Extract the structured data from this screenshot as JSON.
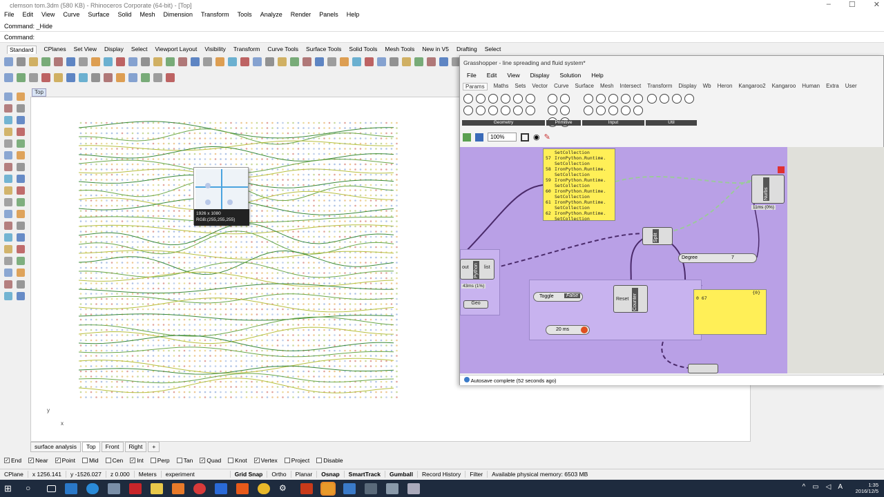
{
  "rhino": {
    "title": "clemson tom.3dm (580 KB) - Rhinoceros Corporate (64-bit) - [Top]",
    "menu": [
      "File",
      "Edit",
      "View",
      "Curve",
      "Surface",
      "Solid",
      "Mesh",
      "Dimension",
      "Transform",
      "Tools",
      "Analyze",
      "Render",
      "Panels",
      "Help"
    ],
    "command_history": "Command: _Hide",
    "command_prompt": "Command:",
    "toolbar_tabs": [
      "Standard",
      "CPlanes",
      "Set View",
      "Display",
      "Select",
      "Viewport Layout",
      "Visibility",
      "Transform",
      "Curve Tools",
      "Surface Tools",
      "Solid Tools",
      "Mesh Tools",
      "New in V5",
      "Drafting",
      "Select"
    ],
    "active_toolbar_tab": "Standard",
    "viewport_name": "Top",
    "axis_y": "y",
    "axis_x": "x",
    "tooltip": {
      "size": "1926 x 1080",
      "rgb": "RGB:(255,255,255)"
    },
    "view_tabs": [
      "surface analysis",
      "Top",
      "Front",
      "Right",
      "+"
    ],
    "active_view_tab": "Top",
    "osnaps": [
      {
        "label": "End",
        "checked": true
      },
      {
        "label": "Near",
        "checked": true
      },
      {
        "label": "Point",
        "checked": true
      },
      {
        "label": "Mid",
        "checked": false
      },
      {
        "label": "Cen",
        "checked": false
      },
      {
        "label": "Int",
        "checked": true
      },
      {
        "label": "Perp",
        "checked": false
      },
      {
        "label": "Tan",
        "checked": false
      },
      {
        "label": "Quad",
        "checked": true
      },
      {
        "label": "Knot",
        "checked": false
      },
      {
        "label": "Vertex",
        "checked": true
      },
      {
        "label": "Project",
        "checked": false
      },
      {
        "label": "Disable",
        "checked": false
      }
    ],
    "status": {
      "cplane": "CPlane",
      "x": "x 1256.141",
      "y": "y -1526.027",
      "z": "z 0.000",
      "units": "Meters",
      "layer": "experiment",
      "grid_snap": "Grid Snap",
      "ortho": "Ortho",
      "planar": "Planar",
      "osnap": "Osnap",
      "smarttrack": "SmartTrack",
      "gumball": "Gumball",
      "record_history": "Record History",
      "filter": "Filter",
      "memory": "Available physical memory: 6503 MB"
    }
  },
  "grasshopper": {
    "title": "Grasshopper - line spreading and fluid system*",
    "menu": [
      "File",
      "Edit",
      "View",
      "Display",
      "Solution",
      "Help"
    ],
    "tabs": [
      "Params",
      "Maths",
      "Sets",
      "Vector",
      "Curve",
      "Surface",
      "Mesh",
      "Intersect",
      "Transform",
      "Display",
      "Wb",
      "Heron",
      "Kangaroo2",
      "Kangaroo",
      "Human",
      "Extra",
      "User"
    ],
    "active_tab": "Params",
    "ribbon_groups": [
      "Geometry",
      "Primitive",
      "Input",
      "Util"
    ],
    "zoom": "100%",
    "panel_lines": [
      {
        "n": "",
        "t": "SetCollection"
      },
      {
        "n": "57",
        "t": "IronPython.Runtime."
      },
      {
        "n": "",
        "t": "SetCollection"
      },
      {
        "n": "58",
        "t": "IronPython.Runtime."
      },
      {
        "n": "",
        "t": "SetCollection"
      },
      {
        "n": "59",
        "t": "IronPython.Runtime."
      },
      {
        "n": "",
        "t": "SetCollection"
      },
      {
        "n": "60",
        "t": "IronPython.Runtime."
      },
      {
        "n": "",
        "t": "SetCollection"
      },
      {
        "n": "61",
        "t": "IronPython.Runtime."
      },
      {
        "n": "",
        "t": "SetCollection"
      },
      {
        "n": "62",
        "t": "IronPython.Runtime."
      },
      {
        "n": "",
        "t": "SetCollection"
      }
    ],
    "python": {
      "label": "Python",
      "out": "out",
      "list": "list",
      "time": "43ms (1%)"
    },
    "geo": "Geo",
    "split": "Split",
    "nurbs": {
      "label": "Nurbs",
      "time": "11ms (0%)"
    },
    "degree": {
      "label": "Degree",
      "value": "7"
    },
    "toggle": {
      "label": "Toggle",
      "value": "False"
    },
    "counter": {
      "label": "Counter",
      "reset": "Reset"
    },
    "timer": "20 ms",
    "output_panel": {
      "header": "{0}",
      "line": "0  67"
    },
    "status": "Autosave complete (52 seconds ago)"
  },
  "taskbar": {
    "time": "1:35",
    "date": "2016/12/5"
  },
  "colors": {
    "gh_canvas": "#b9a0e6",
    "panel_yellow": "#ffef57",
    "taskbar": "#1e2b3e"
  }
}
